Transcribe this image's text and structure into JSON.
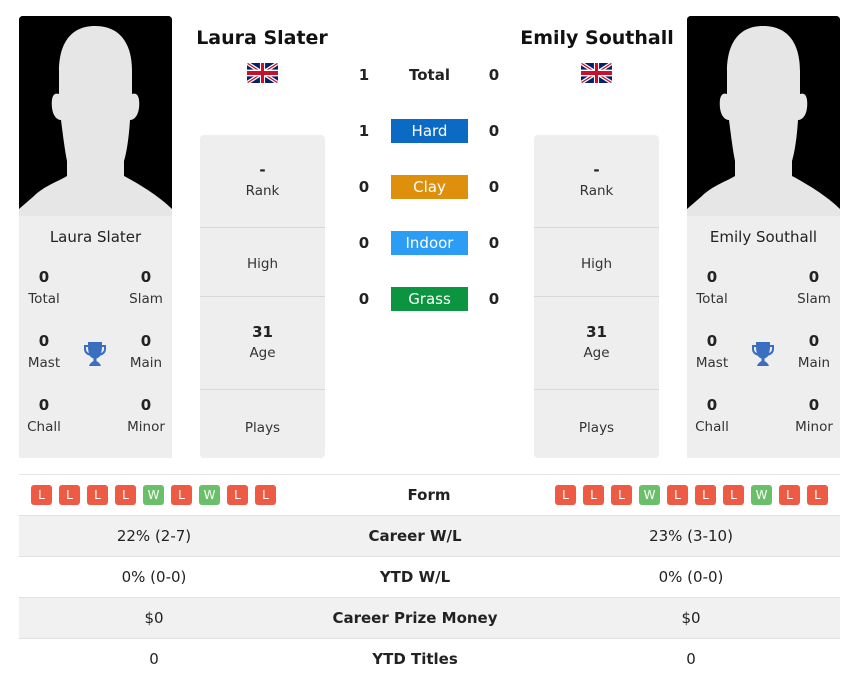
{
  "players": {
    "left": {
      "name": "Laura Slater",
      "country_flag": "uk-flag",
      "titles": {
        "total": {
          "value": "0",
          "label": "Total"
        },
        "slam": {
          "value": "0",
          "label": "Slam"
        },
        "mast": {
          "value": "0",
          "label": "Mast"
        },
        "main": {
          "value": "0",
          "label": "Main"
        },
        "chall": {
          "value": "0",
          "label": "Chall"
        },
        "minor": {
          "value": "0",
          "label": "Minor"
        }
      },
      "info": {
        "rank": {
          "value": "-",
          "label": "Rank"
        },
        "high": {
          "value": "",
          "label": "High"
        },
        "age": {
          "value": "31",
          "label": "Age"
        },
        "plays": {
          "value": "",
          "label": "Plays"
        }
      },
      "form": [
        "L",
        "L",
        "L",
        "L",
        "W",
        "L",
        "W",
        "L",
        "L"
      ]
    },
    "right": {
      "name": "Emily Southall",
      "country_flag": "uk-flag",
      "titles": {
        "total": {
          "value": "0",
          "label": "Total"
        },
        "slam": {
          "value": "0",
          "label": "Slam"
        },
        "mast": {
          "value": "0",
          "label": "Mast"
        },
        "main": {
          "value": "0",
          "label": "Main"
        },
        "chall": {
          "value": "0",
          "label": "Chall"
        },
        "minor": {
          "value": "0",
          "label": "Minor"
        }
      },
      "info": {
        "rank": {
          "value": "-",
          "label": "Rank"
        },
        "high": {
          "value": "",
          "label": "High"
        },
        "age": {
          "value": "31",
          "label": "Age"
        },
        "plays": {
          "value": "",
          "label": "Plays"
        }
      },
      "form": [
        "L",
        "L",
        "L",
        "W",
        "L",
        "L",
        "L",
        "W",
        "L",
        "L"
      ]
    }
  },
  "h2h": [
    {
      "surface": "Total",
      "left": "1",
      "right": "0",
      "color": ""
    },
    {
      "surface": "Hard",
      "left": "1",
      "right": "0",
      "color": "#0a6ac4"
    },
    {
      "surface": "Clay",
      "left": "0",
      "right": "0",
      "color": "#de8f0c"
    },
    {
      "surface": "Indoor",
      "left": "0",
      "right": "0",
      "color": "#2b9df4"
    },
    {
      "surface": "Grass",
      "left": "0",
      "right": "0",
      "color": "#0b9541"
    }
  ],
  "form_label": "Form",
  "stats": [
    {
      "label": "Career W/L",
      "left": "22% (2-7)",
      "right": "23% (3-10)"
    },
    {
      "label": "YTD W/L",
      "left": "0% (0-0)",
      "right": "0% (0-0)"
    },
    {
      "label": "Career Prize Money",
      "left": "$0",
      "right": "$0"
    },
    {
      "label": "YTD Titles",
      "left": "0",
      "right": "0"
    }
  ],
  "colors": {
    "loss": "#ee5b44",
    "win": "#6abf69",
    "trophy": "#3a6fbf"
  }
}
